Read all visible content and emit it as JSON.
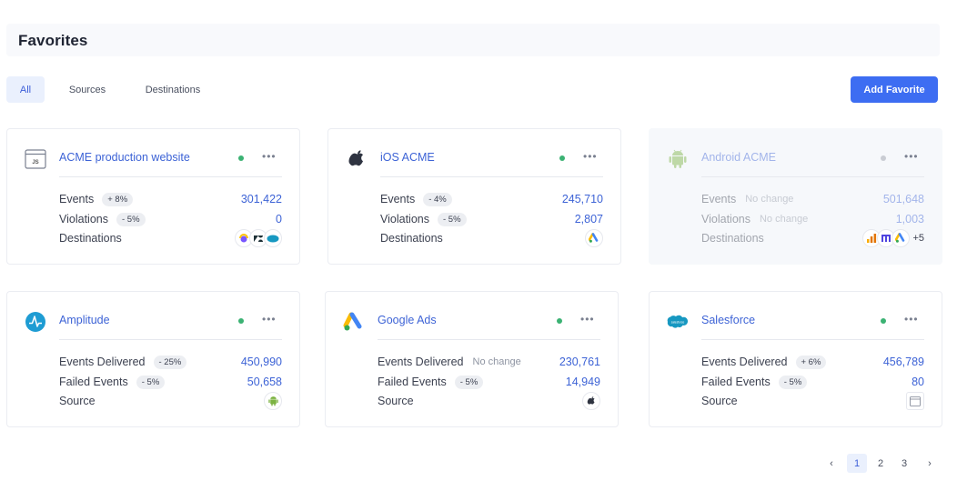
{
  "page": {
    "title": "Favorites"
  },
  "tabs": [
    {
      "label": "All",
      "active": true
    },
    {
      "label": "Sources"
    },
    {
      "label": "Destinations"
    }
  ],
  "actions": {
    "add_favorite": "Add Favorite"
  },
  "cards": [
    {
      "name": "ACME production website",
      "icon": "javascript-icon",
      "status": "active",
      "rows": [
        {
          "label": "Events",
          "change": "+ 8%",
          "value": "301,422"
        },
        {
          "label": "Violations",
          "change": "- 5%",
          "value": "0"
        },
        {
          "label": "Destinations",
          "icons": [
            "mixpanel-icon",
            "zendesk-icon",
            "salesforce-icon"
          ]
        }
      ]
    },
    {
      "name": "iOS ACME",
      "icon": "apple-icon",
      "status": "active",
      "rows": [
        {
          "label": "Events",
          "change": "- 4%",
          "value": "245,710"
        },
        {
          "label": "Violations",
          "change": "- 5%",
          "value": "2,807"
        },
        {
          "label": "Destinations",
          "icons": [
            "google-ads-icon"
          ]
        }
      ]
    },
    {
      "name": "Android ACME",
      "icon": "android-icon",
      "status": "disabled",
      "rows": [
        {
          "label": "Events",
          "change": "No change",
          "value": "501,648"
        },
        {
          "label": "Violations",
          "change": "No change",
          "value": "1,003"
        },
        {
          "label": "Destinations",
          "icons": [
            "google-analytics-icon",
            "mixpanel-icon",
            "google-ads-icon"
          ],
          "extra": "+5"
        }
      ]
    },
    {
      "name": "Amplitude",
      "icon": "amplitude-icon",
      "status": "active",
      "rows": [
        {
          "label": "Events Delivered",
          "change": "- 25%",
          "value": "450,990"
        },
        {
          "label": "Failed Events",
          "change": "- 5%",
          "value": "50,658"
        },
        {
          "label": "Source",
          "icons": [
            "android-icon"
          ]
        }
      ]
    },
    {
      "name": "Google Ads",
      "icon": "google-ads-icon",
      "status": "active",
      "rows": [
        {
          "label": "Events Delivered",
          "change": "No change",
          "value": "230,761"
        },
        {
          "label": "Failed Events",
          "change": "- 5%",
          "value": "14,949"
        },
        {
          "label": "Source",
          "icons": [
            "apple-icon"
          ]
        }
      ]
    },
    {
      "name": "Salesforce",
      "icon": "salesforce-icon",
      "status": "active",
      "rows": [
        {
          "label": "Events Delivered",
          "change": "+ 6%",
          "value": "456,789"
        },
        {
          "label": "Failed Events",
          "change": "- 5%",
          "value": "80"
        },
        {
          "label": "Source",
          "icons": [
            "javascript-icon"
          ]
        }
      ]
    }
  ],
  "pagination": {
    "prev": "‹",
    "pages": [
      "1",
      "2",
      "3"
    ],
    "current": "1",
    "next": "›"
  },
  "colors": {
    "accent": "#3d6df2",
    "link": "#3d63d6",
    "status_active": "#3bb273"
  }
}
